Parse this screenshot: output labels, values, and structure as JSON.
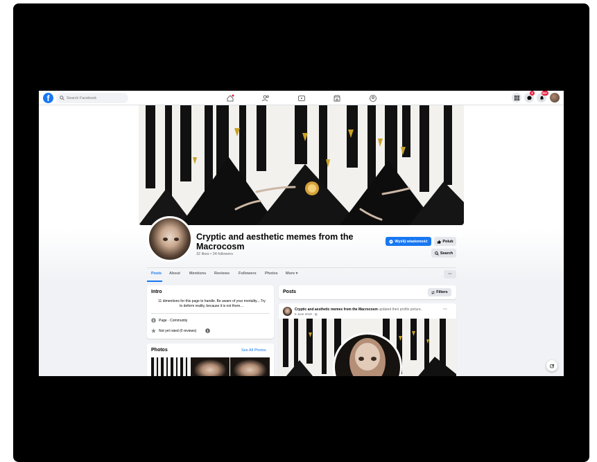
{
  "topnav": {
    "logo": "f",
    "search_placeholder": "Search Facebook",
    "icons": [
      "home-icon",
      "friends-icon",
      "watch-icon",
      "marketplace-icon",
      "groups-icon"
    ],
    "right_icons": [
      "menu-grid-icon",
      "messenger-icon",
      "bell-icon"
    ],
    "messenger_badge": "2",
    "notifications_badge": "20+"
  },
  "page": {
    "title": "Cryptic and aesthetic memes from the Macrocosm",
    "stats": "32 likes • 34 followers",
    "message_button": "Wyślij wiadomość",
    "like_button": "Polub",
    "search_button": "Search",
    "more_button": "···"
  },
  "tabs": [
    "Posts",
    "About",
    "Mentions",
    "Reviews",
    "Followers",
    "Photos",
    "More ▾"
  ],
  "intro": {
    "title": "Intro",
    "bio": "11 dimentions for this page to handle. Be aware of your mortality....Try to deform reality, because it is not there....",
    "category": "Page · Community",
    "rating": "Not yet rated (0 reviews)"
  },
  "photos": {
    "title": "Photos",
    "see_all": "See All Photos"
  },
  "posts": {
    "title": "Posts",
    "filters": "Filters",
    "post_author": "Cryptic and aesthetic memes from the Macrocosm",
    "post_action": "updated their profile picture.",
    "post_date": "5 June 2018 · ",
    "post_more": "···"
  },
  "colors": {
    "accent": "#1877f2",
    "badge": "#e41e3f",
    "background": "#f0f2f5"
  }
}
